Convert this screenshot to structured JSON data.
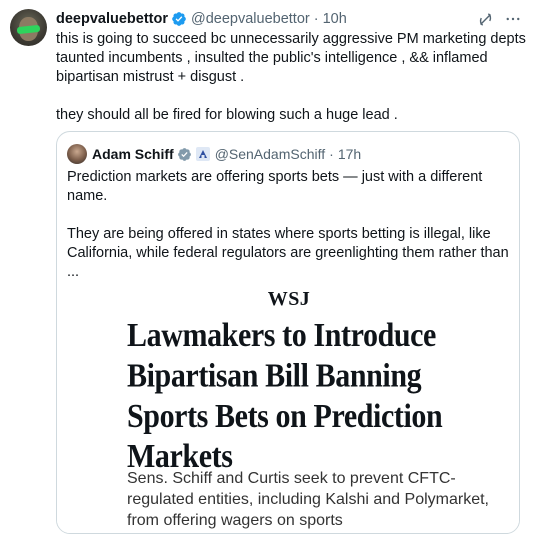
{
  "tweet": {
    "author_name": "deepvaluebettor",
    "author_handle": "@deepvaluebettor",
    "separator": "·",
    "time": "10h",
    "text": "this is going to succeed bc unnecessarily aggressive PM marketing depts taunted incumbents , insulted the public's intelligence , && inflamed bipartisan mistrust + disgust .\n\nthey should all be fired for blowing such a huge lead ."
  },
  "quoted_tweet": {
    "author_name": "Adam Schiff",
    "author_handle": "@SenAdamSchiff",
    "separator": "·",
    "time": "17h",
    "text": "Prediction markets are offering sports bets — just with a different name.\n\nThey are being offered in states where sports betting is illegal, like California, while federal regulators are greenlighting them rather than ..."
  },
  "article": {
    "outlet": "WSJ",
    "headline": "Lawmakers to Introduce Bipartisan Bill Banning Sports Bets on Prediction Markets",
    "subhead": "Sens. Schiff and Curtis seek to prevent CFTC-regulated entities, including Kalshi and Polymarket, from offering wagers on sports"
  },
  "icons": {
    "verified": "verified-badge-icon",
    "grok": "grok-icon",
    "more": "more-icon",
    "gov": "government-affiliation-icon"
  },
  "colors": {
    "verified_blue": "#1d9bf0",
    "verified_gray": "#829aab",
    "text_secondary": "#536471",
    "border": "#cfd9de"
  }
}
